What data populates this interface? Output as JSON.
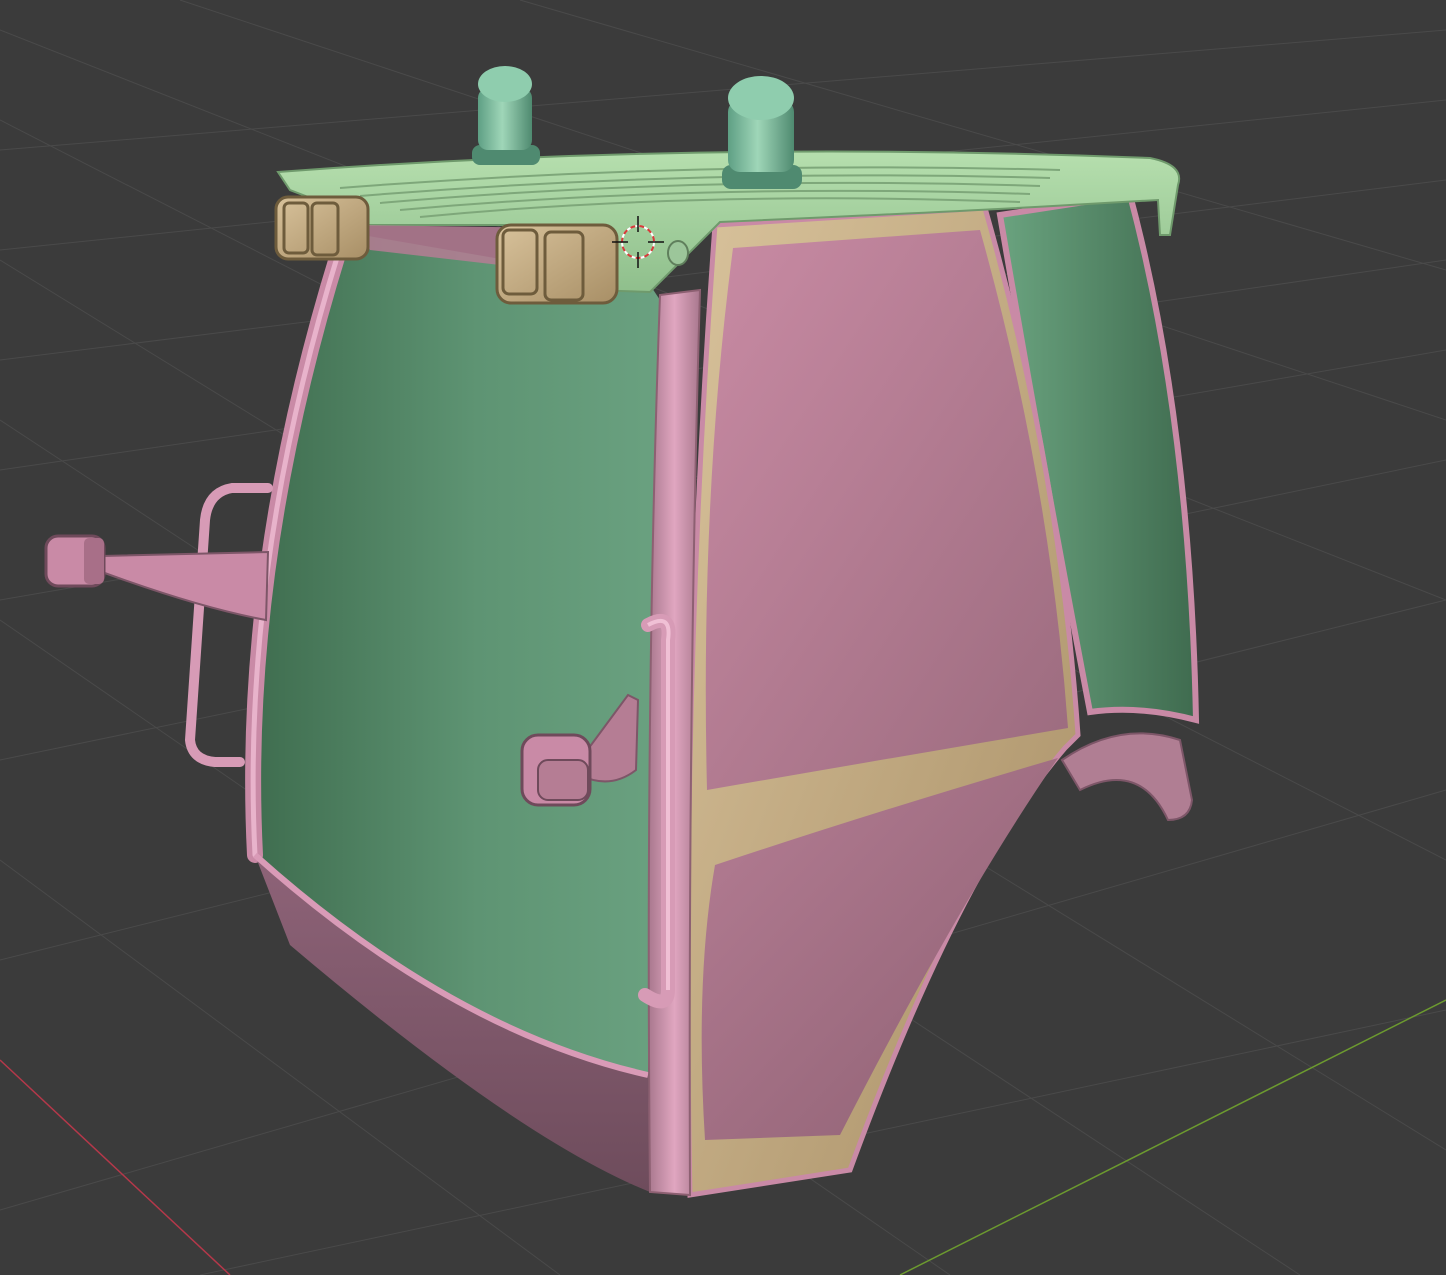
{
  "viewport": {
    "background": "#3b3b3b",
    "grid_color": "#545454",
    "axis_x_color": "#b5384a",
    "axis_y_color": "#6c9a2f"
  },
  "model": {
    "pink": "#c98aa6",
    "pink_dark": "#8a5a70",
    "green": "#5f9a77",
    "green_dark": "#3d6b4e",
    "green_light": "#9fd2a4",
    "tan": "#c2a77c",
    "tan_dark": "#8a7550"
  },
  "icons": {
    "cursor": "3d-cursor-icon"
  }
}
